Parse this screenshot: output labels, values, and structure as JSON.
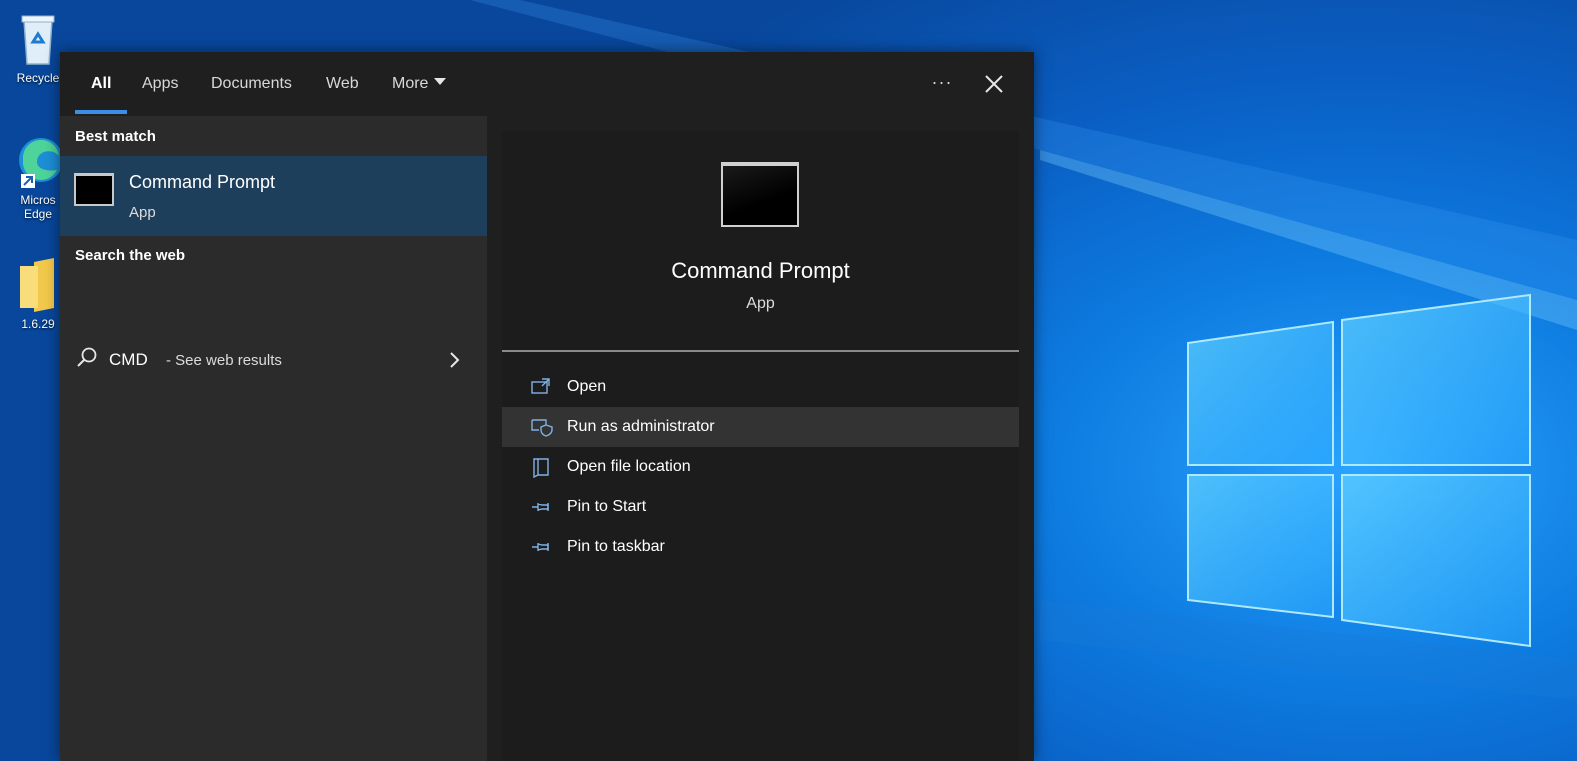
{
  "desktop": {
    "icons": [
      {
        "label": "Recycle",
        "icon": "recycle-bin-icon"
      },
      {
        "label": "Micros\nEdge",
        "icon": "microsoft-edge-icon"
      },
      {
        "label": "1.6.29",
        "icon": "folder-icon"
      }
    ]
  },
  "search": {
    "tabs": [
      {
        "label": "All",
        "active": true
      },
      {
        "label": "Apps"
      },
      {
        "label": "Documents"
      },
      {
        "label": "Web"
      },
      {
        "label": "More"
      }
    ],
    "ellipsis": "···",
    "best_match_header": "Best match",
    "best_match": {
      "title": "Command Prompt",
      "subtitle": "App",
      "icon": "command-prompt-icon"
    },
    "web_header": "Search the web",
    "web_result": {
      "query": "CMD",
      "suffix": "- See web results"
    },
    "preview": {
      "title": "Command Prompt",
      "subtitle": "App",
      "actions": [
        {
          "label": "Open",
          "icon": "open-icon"
        },
        {
          "label": "Run as administrator",
          "icon": "run-as-admin-icon",
          "highlighted": true
        },
        {
          "label": "Open file location",
          "icon": "file-location-icon"
        },
        {
          "label": "Pin to Start",
          "icon": "pin-icon"
        },
        {
          "label": "Pin to taskbar",
          "icon": "pin-icon"
        }
      ]
    }
  },
  "colors": {
    "accent": "#3a8ee6",
    "selected_bg": "#1e3f5c",
    "panel_bg": "#1f1f1f",
    "left_pane_bg": "#2b2b2b",
    "hover_bg": "#333333"
  }
}
